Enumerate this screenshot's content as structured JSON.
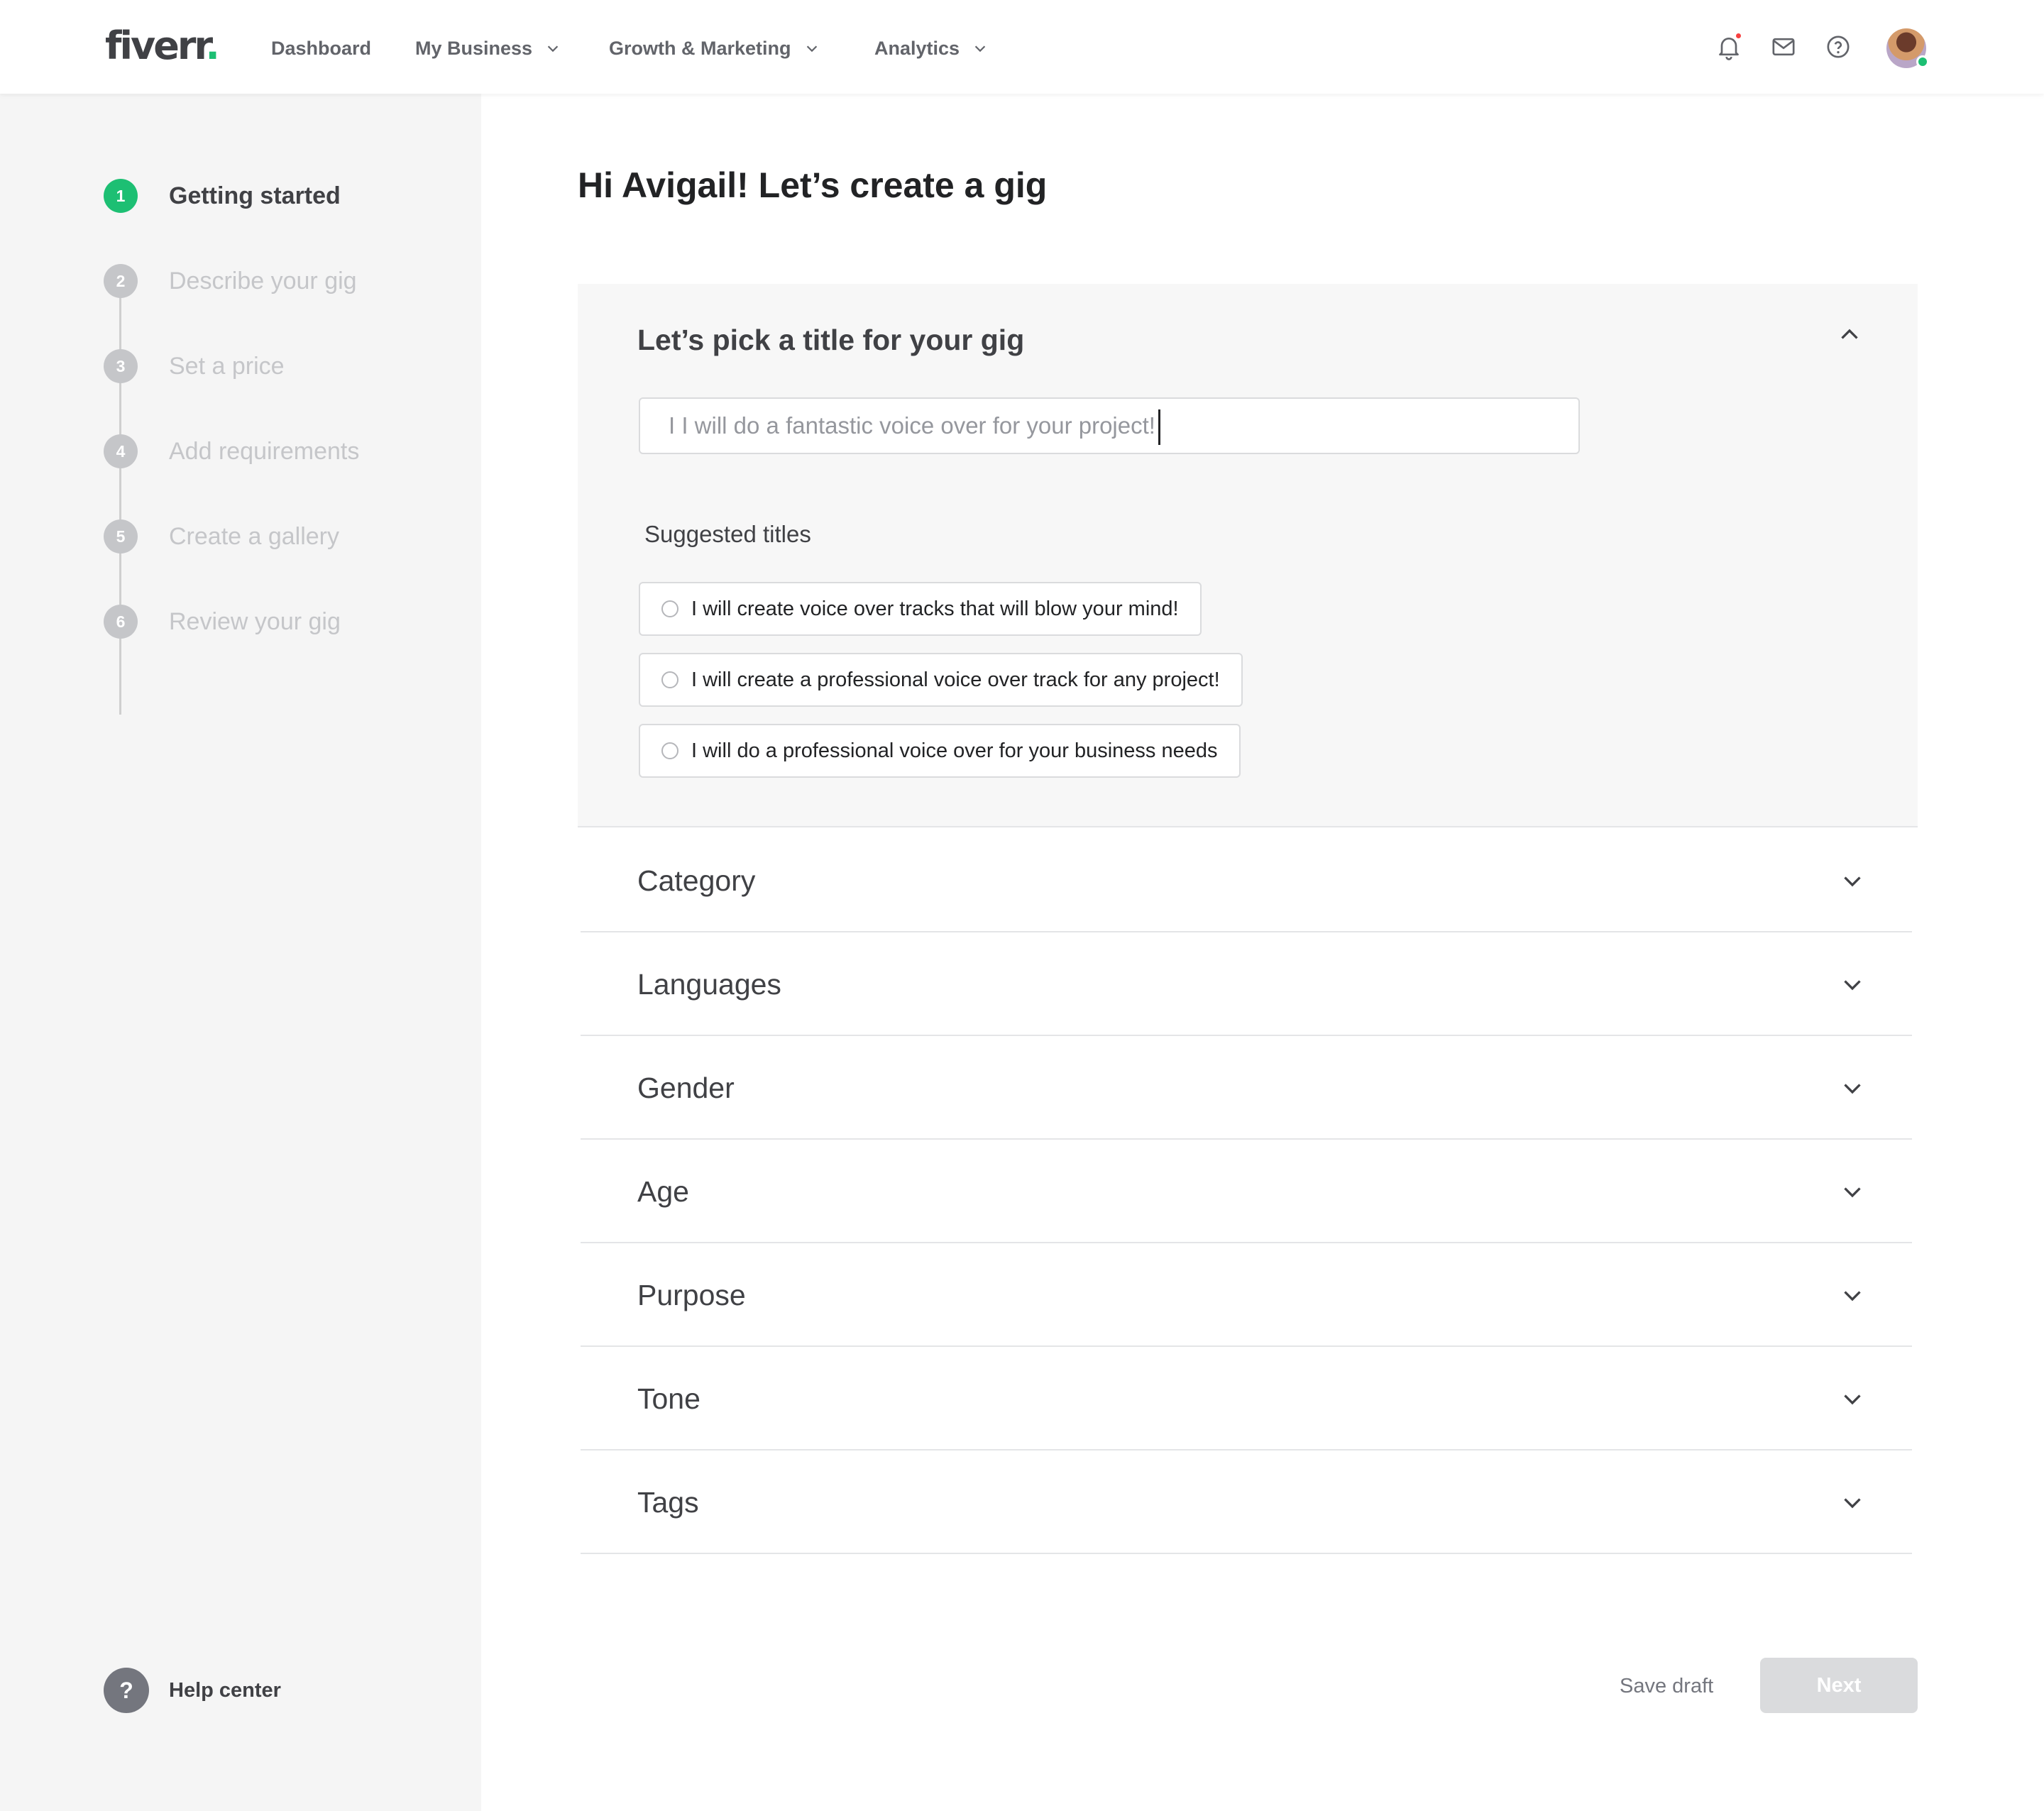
{
  "header": {
    "logo": "fiverr",
    "logo_dot": ".",
    "nav": [
      {
        "label": "Dashboard"
      },
      {
        "label": "My Business"
      },
      {
        "label": "Growth & Marketing"
      },
      {
        "label": "Analytics"
      }
    ],
    "icons": [
      "bell-icon",
      "envelope-icon",
      "help-circle-icon",
      "avatar"
    ]
  },
  "sidebar": {
    "steps": [
      {
        "num": "1",
        "label": "Getting started",
        "active": true
      },
      {
        "num": "2",
        "label": "Describe your gig",
        "active": false
      },
      {
        "num": "3",
        "label": "Set a price",
        "active": false
      },
      {
        "num": "4",
        "label": "Add requirements",
        "active": false
      },
      {
        "num": "5",
        "label": "Create a gallery",
        "active": false
      },
      {
        "num": "6",
        "label": "Review your gig",
        "active": false
      }
    ],
    "help": {
      "icon": "?",
      "label": "Help center"
    }
  },
  "main": {
    "title": "Hi Avigail! Let’s create a gig",
    "title_panel": {
      "heading": "Let’s pick a title for your gig",
      "input_value": "I I will do a fantastic voice over for your project!",
      "suggested_label": "Suggested titles",
      "suggestions": [
        "I will create voice over tracks that will blow your mind!",
        "I will create a professional voice over track for any project!",
        "I will do a professional voice over for your business needs"
      ]
    },
    "sections": [
      "Category",
      "Languages",
      "Gender",
      "Age",
      "Purpose",
      "Tone",
      "Tags"
    ]
  },
  "footer": {
    "save_draft": "Save draft",
    "next": "Next"
  },
  "colors": {
    "accent": "#1dbf73",
    "sidebar_bg": "#f5f5f5",
    "disabled": "#c5c6c9",
    "notification": "#f74040"
  }
}
